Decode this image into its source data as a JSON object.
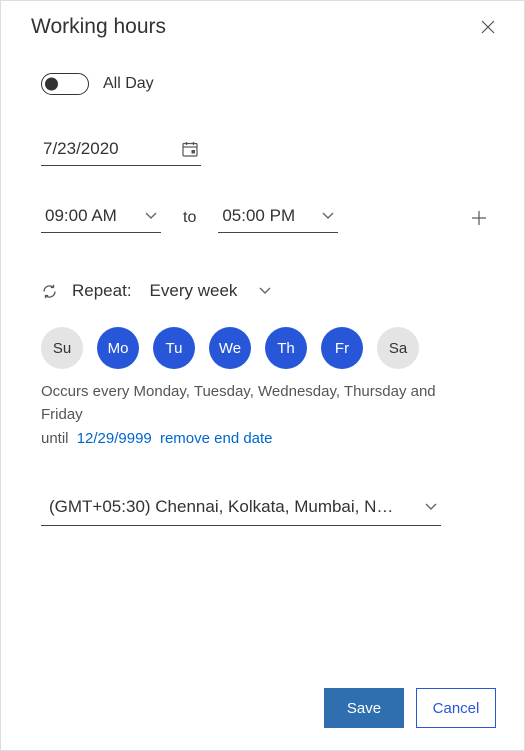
{
  "dialog": {
    "title": "Working hours",
    "toggle": {
      "label": "All Day",
      "on": false
    },
    "date": "7/23/2020",
    "time": {
      "start": "09:00 AM",
      "to": "to",
      "end": "05:00 PM"
    },
    "repeat": {
      "label": "Repeat:",
      "value": "Every week"
    },
    "days": {
      "su": "Su",
      "mo": "Mo",
      "tu": "Tu",
      "we": "We",
      "th": "Th",
      "fr": "Fr",
      "sa": "Sa"
    },
    "occurs": "Occurs every Monday, Tuesday, Wednesday, Thursday and Friday",
    "until_label": "until",
    "until_date": "12/29/9999",
    "remove_end": "remove end date",
    "timezone": "(GMT+05:30) Chennai, Kolkata, Mumbai, Ne...",
    "save": "Save",
    "cancel": "Cancel"
  }
}
